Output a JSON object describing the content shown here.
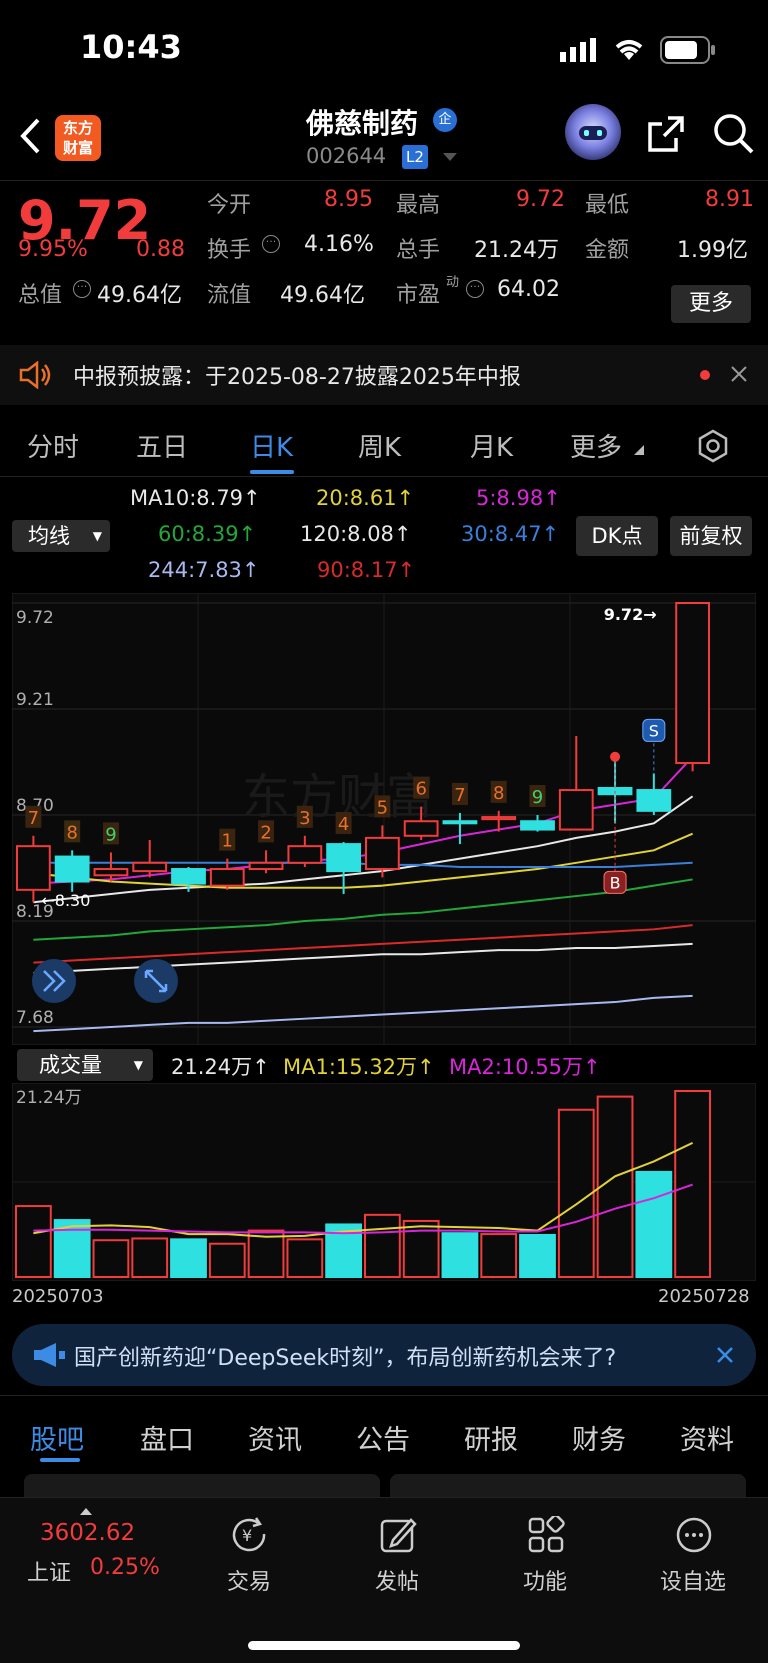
{
  "status_bar": {
    "time": "10:43"
  },
  "header": {
    "logo_text": "东方财富",
    "stock_name": "佛慈制药",
    "badge": "企",
    "stock_code": "002644",
    "level": "L2"
  },
  "quote": {
    "price": "9.72",
    "change_pct": "9.95%",
    "change": "0.88",
    "open_label": "今开",
    "open": "8.95",
    "high_label": "最高",
    "high": "9.72",
    "low_label": "最低",
    "low": "8.91",
    "turnover_label": "换手",
    "turnover": "4.16%",
    "volume_label": "总手",
    "volume": "21.24万",
    "amount_label": "金额",
    "amount": "1.99亿",
    "mktcap_label": "总值",
    "mktcap": "49.64亿",
    "float_label": "流值",
    "float_cap": "49.64亿",
    "pe_label": "市盈",
    "pe_sup": "动",
    "pe": "64.02",
    "more": "更多"
  },
  "notice": {
    "text": "中报预披露：于2025-08-27披露2025年中报"
  },
  "tabs": [
    {
      "label": "分时"
    },
    {
      "label": "五日"
    },
    {
      "label": "日K"
    },
    {
      "label": "周K"
    },
    {
      "label": "月K"
    },
    {
      "label": "更多"
    }
  ],
  "ma_legend": {
    "ma10": "MA10:8.79↑",
    "ma20": "20:8.61↑",
    "ma5": "5:8.98↑",
    "ma60": "60:8.39↑",
    "ma120": "120:8.08↑",
    "ma30": "30:8.47↑",
    "ma244": "244:7.83↑",
    "ma90": "90:8.17↑",
    "indicator": "均线",
    "dk": "DK点",
    "adjust": "前复权"
  },
  "chart_data": [
    {
      "type": "candlestick",
      "y_ticks": [
        "9.72",
        "9.21",
        "8.70",
        "8.19",
        "7.68"
      ],
      "ylim": [
        7.68,
        9.72
      ],
      "high_marker": "9.72→",
      "low_marker": "←8.30",
      "candles": [
        {
          "o": 8.34,
          "c": 8.55,
          "h": 8.6,
          "l": 8.28,
          "n": "7"
        },
        {
          "o": 8.5,
          "c": 8.38,
          "h": 8.53,
          "l": 8.33,
          "n": "8"
        },
        {
          "o": 8.41,
          "c": 8.44,
          "h": 8.52,
          "l": 8.38,
          "n": "9"
        },
        {
          "o": 8.43,
          "c": 8.47,
          "h": 8.58,
          "l": 8.4,
          "n": ""
        },
        {
          "o": 8.44,
          "c": 8.37,
          "h": 8.45,
          "l": 8.33,
          "n": ""
        },
        {
          "o": 8.36,
          "c": 8.44,
          "h": 8.49,
          "l": 8.34,
          "n": "1"
        },
        {
          "o": 8.44,
          "c": 8.47,
          "h": 8.53,
          "l": 8.42,
          "n": "2"
        },
        {
          "o": 8.47,
          "c": 8.55,
          "h": 8.6,
          "l": 8.45,
          "n": "3"
        },
        {
          "o": 8.56,
          "c": 8.43,
          "h": 8.57,
          "l": 8.32,
          "n": "4"
        },
        {
          "o": 8.44,
          "c": 8.59,
          "h": 8.65,
          "l": 8.4,
          "n": "5"
        },
        {
          "o": 8.6,
          "c": 8.67,
          "h": 8.74,
          "l": 8.58,
          "n": "6"
        },
        {
          "o": 8.67,
          "c": 8.66,
          "h": 8.71,
          "l": 8.56,
          "n": "7"
        },
        {
          "o": 8.68,
          "c": 8.69,
          "h": 8.72,
          "l": 8.62,
          "n": "8"
        },
        {
          "o": 8.67,
          "c": 8.63,
          "h": 8.7,
          "l": 8.62,
          "n": "9"
        },
        {
          "o": 8.63,
          "c": 8.82,
          "h": 9.08,
          "l": 8.63,
          "n": ""
        },
        {
          "o": 8.83,
          "c": 8.8,
          "h": 8.98,
          "l": 8.66,
          "n": ""
        },
        {
          "o": 8.82,
          "c": 8.72,
          "h": 8.9,
          "l": 8.7,
          "n": ""
        },
        {
          "o": 8.95,
          "c": 9.72,
          "h": 9.72,
          "l": 8.91,
          "n": ""
        }
      ],
      "signals": {
        "S": "S",
        "B": "B"
      },
      "ma_lines": [
        {
          "name": "5",
          "color": "#d925d9",
          "values": [
            8.37,
            8.38,
            8.39,
            8.41,
            8.43,
            8.44,
            8.46,
            8.48,
            8.49,
            8.52,
            8.56,
            8.6,
            8.63,
            8.66,
            8.72,
            8.75,
            8.78,
            8.98
          ]
        },
        {
          "name": "10",
          "color": "#e8e8e8",
          "values": [
            8.28,
            8.3,
            8.32,
            8.34,
            8.35,
            8.36,
            8.37,
            8.39,
            8.41,
            8.43,
            8.46,
            8.49,
            8.52,
            8.55,
            8.59,
            8.62,
            8.66,
            8.79
          ]
        },
        {
          "name": "20",
          "color": "#e2d23a",
          "values": [
            8.42,
            8.4,
            8.38,
            8.37,
            8.36,
            8.35,
            8.35,
            8.35,
            8.35,
            8.36,
            8.38,
            8.4,
            8.42,
            8.44,
            8.47,
            8.5,
            8.53,
            8.61
          ]
        },
        {
          "name": "30",
          "color": "#3a7fd9",
          "values": [
            8.47,
            8.47,
            8.47,
            8.47,
            8.47,
            8.47,
            8.47,
            8.47,
            8.47,
            8.46,
            8.46,
            8.45,
            8.45,
            8.45,
            8.45,
            8.45,
            8.46,
            8.47
          ]
        },
        {
          "name": "60",
          "color": "#22a83a",
          "values": [
            8.1,
            8.11,
            8.12,
            8.14,
            8.15,
            8.16,
            8.17,
            8.19,
            8.2,
            8.22,
            8.23,
            8.25,
            8.27,
            8.29,
            8.31,
            8.33,
            8.36,
            8.39
          ]
        },
        {
          "name": "90",
          "color": "#d92a2a",
          "values": [
            7.99,
            8.0,
            8.01,
            8.02,
            8.03,
            8.04,
            8.05,
            8.06,
            8.07,
            8.08,
            8.09,
            8.1,
            8.11,
            8.12,
            8.13,
            8.14,
            8.15,
            8.17
          ]
        },
        {
          "name": "120",
          "color": "#e8e8e8",
          "values": [
            7.94,
            7.95,
            7.96,
            7.97,
            7.98,
            7.99,
            8.0,
            8.01,
            8.02,
            8.03,
            8.03,
            8.04,
            8.05,
            8.05,
            8.06,
            8.06,
            8.07,
            8.08
          ]
        },
        {
          "name": "244",
          "color": "#a9b9f0",
          "values": [
            7.66,
            7.67,
            7.68,
            7.69,
            7.7,
            7.7,
            7.71,
            7.72,
            7.73,
            7.74,
            7.75,
            7.76,
            7.77,
            7.78,
            7.79,
            7.8,
            7.82,
            7.83
          ]
        }
      ]
    },
    {
      "type": "bar",
      "label": "成交量",
      "current": "21.24万↑",
      "ma1": "MA1:15.32万↑",
      "ma2": "MA2:10.55万↑",
      "y_top": "21.24万",
      "x_start": "20250703",
      "x_end": "20250728",
      "ylim": [
        0,
        21.24
      ],
      "values": [
        {
          "v": 8.1,
          "up": true
        },
        {
          "v": 6.5,
          "up": false
        },
        {
          "v": 4.2,
          "up": true
        },
        {
          "v": 4.4,
          "up": true
        },
        {
          "v": 4.3,
          "up": false
        },
        {
          "v": 3.8,
          "up": true
        },
        {
          "v": 5.3,
          "up": true
        },
        {
          "v": 4.3,
          "up": true
        },
        {
          "v": 6.0,
          "up": false
        },
        {
          "v": 7.1,
          "up": true
        },
        {
          "v": 6.4,
          "up": true
        },
        {
          "v": 5.0,
          "up": false
        },
        {
          "v": 4.9,
          "up": true
        },
        {
          "v": 4.8,
          "up": false
        },
        {
          "v": 19.1,
          "up": true
        },
        {
          "v": 20.6,
          "up": true
        },
        {
          "v": 12.0,
          "up": false
        },
        {
          "v": 21.24,
          "up": true
        }
      ],
      "ma1_values": [
        5.0,
        5.8,
        5.9,
        5.7,
        4.9,
        4.9,
        4.6,
        4.7,
        5.2,
        5.5,
        5.8,
        5.7,
        5.6,
        5.3,
        8.3,
        11.5,
        13.2,
        15.32
      ],
      "ma2_values": [
        5.3,
        5.4,
        5.4,
        5.3,
        5.2,
        5.1,
        5.1,
        5.1,
        5.0,
        5.1,
        5.3,
        5.3,
        5.2,
        5.2,
        6.3,
        7.8,
        9.0,
        10.55
      ]
    }
  ],
  "news": {
    "text": "国产创新药迎“DeepSeek时刻”，布局创新药机会来了?"
  },
  "bottom_tabs": [
    {
      "label": "股吧"
    },
    {
      "label": "盘口"
    },
    {
      "label": "资讯"
    },
    {
      "label": "公告"
    },
    {
      "label": "研报"
    },
    {
      "label": "财务"
    },
    {
      "label": "资料"
    }
  ],
  "nav": {
    "index_value": "3602.62",
    "index_name": "上证",
    "index_change": "0.25%",
    "items": [
      {
        "label": "交易"
      },
      {
        "label": "发帖"
      },
      {
        "label": "功能"
      },
      {
        "label": "设自选"
      }
    ]
  },
  "colors": {
    "up": "#f23c3c",
    "down": "#2ee0e0",
    "accent": "#3c8ce6",
    "count": "#e8702a"
  }
}
